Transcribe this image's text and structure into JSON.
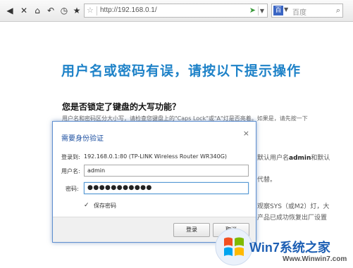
{
  "browser": {
    "address_url": "http://192.168.0.1/",
    "search_placeholder": "百度",
    "search_engine_glyph": "百"
  },
  "page": {
    "error_title": "用户名或密码有误，请按以下提示操作",
    "caps_question": "您是否锁定了键盘的大写功能？",
    "caps_detail": "用户名和密码区分大小写，请检查您键盘上的\"Caps Lock\"或\"A\"灯是否亮着。如果是，请先按一下",
    "bg_line1_pre": "默认用户名",
    "bg_line1_bold": "admin",
    "bg_line1_post": "和默认",
    "bg_line2": "代替。",
    "bg_line3": "观察SYS（或M2）灯，大",
    "bg_line4": "产品已成功恢复出厂设置"
  },
  "dialog": {
    "title": "需要身份验证",
    "close_glyph": "×",
    "login_to_label": "登录到:",
    "login_to_value": "192.168.0.1:80 (TP-LINK Wireless Router WR340G)",
    "username_label": "用户名:",
    "username_value": "admin",
    "password_label": "密码:",
    "password_masked": "●●●●●●●●●●●",
    "remember_label": "保存密码",
    "remember_checked": true,
    "login_button": "登录",
    "cancel_button": "取消"
  },
  "watermark": {
    "brand": "Win7系统之家",
    "url": "Www.Winwin7.com"
  },
  "colors": {
    "title_blue": "#1e82c8",
    "dialog_title": "#1c4fa0",
    "dialog_border": "#5f8fd0"
  }
}
